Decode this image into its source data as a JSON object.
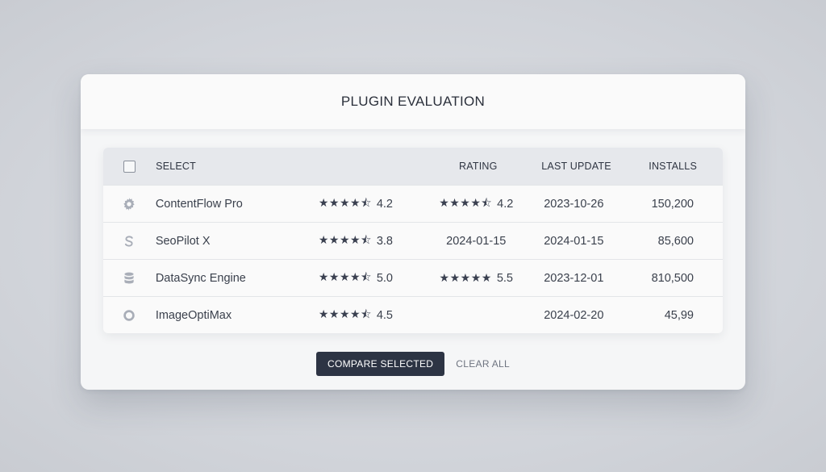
{
  "dialog": {
    "title": "PLUGIN EVALUATION"
  },
  "table": {
    "headers": {
      "select": "SELECT",
      "rating_col1": "",
      "rating_col2": "RATING",
      "last_update": "LAST UPDATE",
      "installs": "INSTALLS"
    },
    "rows": [
      {
        "icon": "gear-icon",
        "name": "ContentFlow Pro",
        "rating1_stars": "★★★★⯪",
        "rating1_value": "4.2",
        "col2_stars": "★★★★⯪",
        "col2_value": "4.2",
        "last_update": "2023-10-26",
        "installs": "150,200"
      },
      {
        "icon": "s-icon",
        "name": "SeoPilot X",
        "rating1_stars": "★★★★⯪",
        "rating1_value": "3.8",
        "col2_stars": "",
        "col2_value": "2024-01-15",
        "last_update": "2024-01-15",
        "installs": "85,600"
      },
      {
        "icon": "database-icon",
        "name": "DataSync Engine",
        "rating1_stars": "★★★★⯪",
        "rating1_value": "5.0",
        "col2_stars": "★★★★★",
        "col2_value": "5.5",
        "last_update": "2023-12-01",
        "installs": "810,500"
      },
      {
        "icon": "ring-icon",
        "name": "ImageOptiMax",
        "rating1_stars": "★★★★⯪",
        "rating1_value": "4.5",
        "col2_stars": "",
        "col2_value": "",
        "last_update": "2024-02-20",
        "installs": "45,99"
      }
    ]
  },
  "actions": {
    "compare_label": "COMPARE SELECTED",
    "clear_label": "CLEAR ALL"
  },
  "colors": {
    "primary_button": "#2d3444",
    "header_row": "#e6e8ec",
    "icon_gray": "#a9aeb8"
  }
}
